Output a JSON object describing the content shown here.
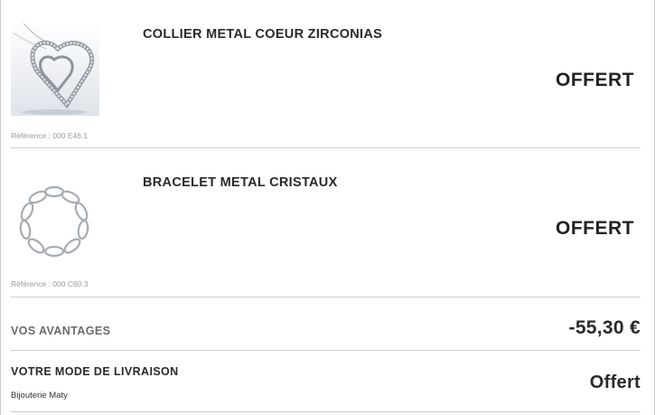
{
  "cart": {
    "items": [
      {
        "name": "COLLIER METAL COEUR ZIRCONIAS",
        "price": "OFFERT",
        "reference": "Référence : 000 E46.1",
        "image_icon": "heart-pendant-necklace-icon"
      },
      {
        "name": "BRACELET METAL CRISTAUX",
        "price": "OFFERT",
        "reference": "Référence : 000 C60.3",
        "image_icon": "chain-bracelet-icon"
      }
    ]
  },
  "advantages": {
    "label": "VOS AVANTAGES",
    "value": "-55,30 €"
  },
  "shipping": {
    "label": "VOTRE MODE DE LIVRAISON",
    "method": "Bijouterie Maty",
    "value": "Offert"
  }
}
